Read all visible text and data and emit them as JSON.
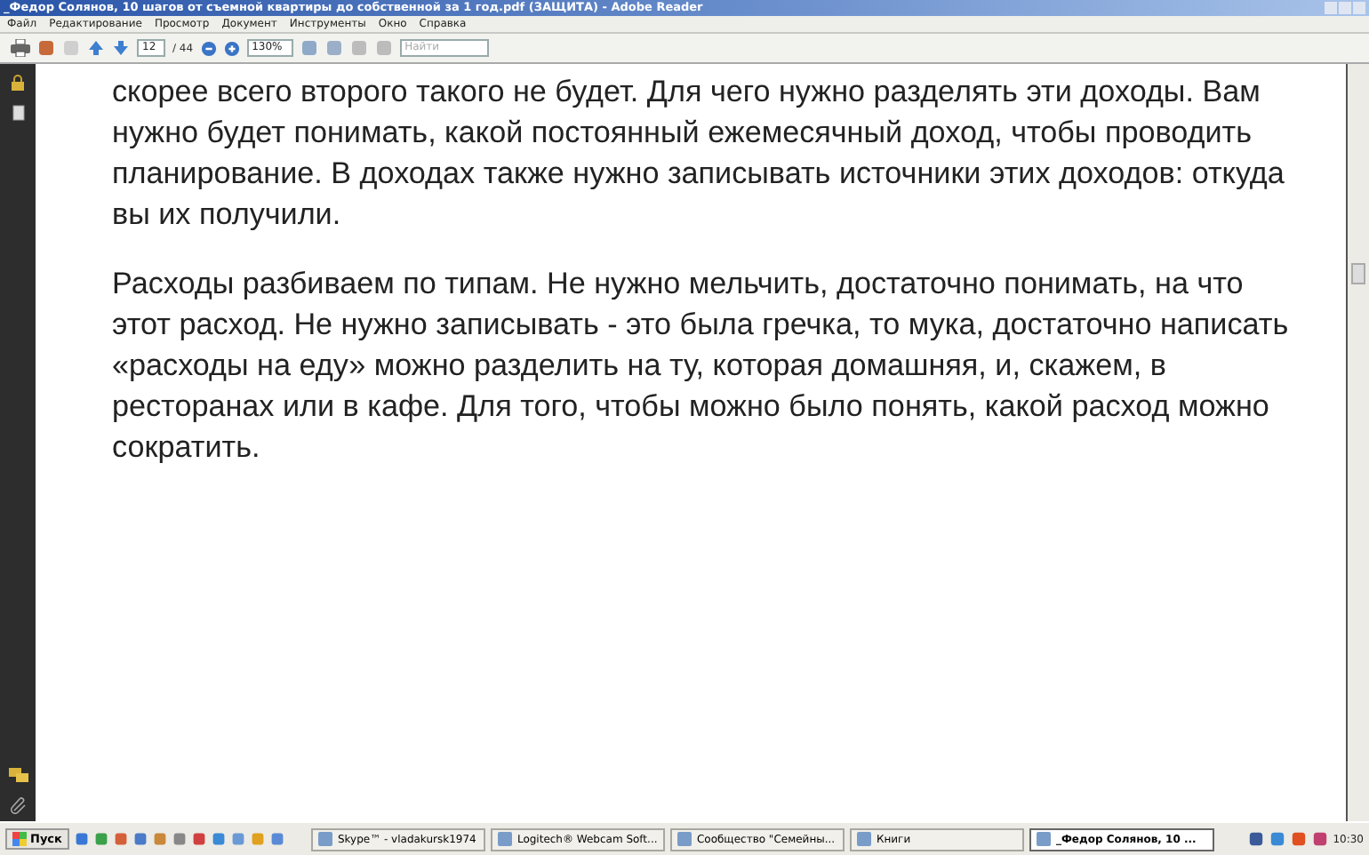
{
  "window": {
    "title": "_Федор Солянов, 10 шагов от съемной квартиры до  собственной за 1 год.pdf (ЗАЩИТА) - Adobe Reader"
  },
  "menu": [
    "Файл",
    "Редактирование",
    "Просмотр",
    "Документ",
    "Инструменты",
    "Окно",
    "Справка"
  ],
  "toolbar": {
    "page": "12",
    "page_count": "/ 44",
    "zoom": "130%",
    "search": {
      "placeholder": "Найти"
    }
  },
  "document": {
    "paragraphs": [
      "скорее всего второго такого не будет. Для чего нужно разделять эти доходы. Вам нужно будет понимать, какой постоянный ежемесячный доход, чтобы проводить планирование. В доходах также нужно записывать источники этих доходов: откуда вы их получили.",
      "Расходы разбиваем по типам. Не нужно мельчить, достаточно понимать, на что этот расход. Не нужно записывать -  это была гречка, то мука,  достаточно написать «расходы на еду»  можно разделить на ту, которая домашняя, и, скажем, в ресторанах или в кафе.  Для того, чтобы можно было понять, какой расход можно сократить."
    ]
  },
  "taskbar": {
    "start": "Пуск",
    "tasks": [
      {
        "label": "Skype™ - vladakursk1974",
        "selected": false
      },
      {
        "label": "Logitech® Webcam Soft...",
        "selected": false
      },
      {
        "label": "Сообщество \"Семейны...",
        "selected": false
      },
      {
        "label": "Книги",
        "selected": false
      },
      {
        "label": "_Федор Солянов, 10 ...",
        "selected": true
      }
    ],
    "clock": "10:30"
  }
}
